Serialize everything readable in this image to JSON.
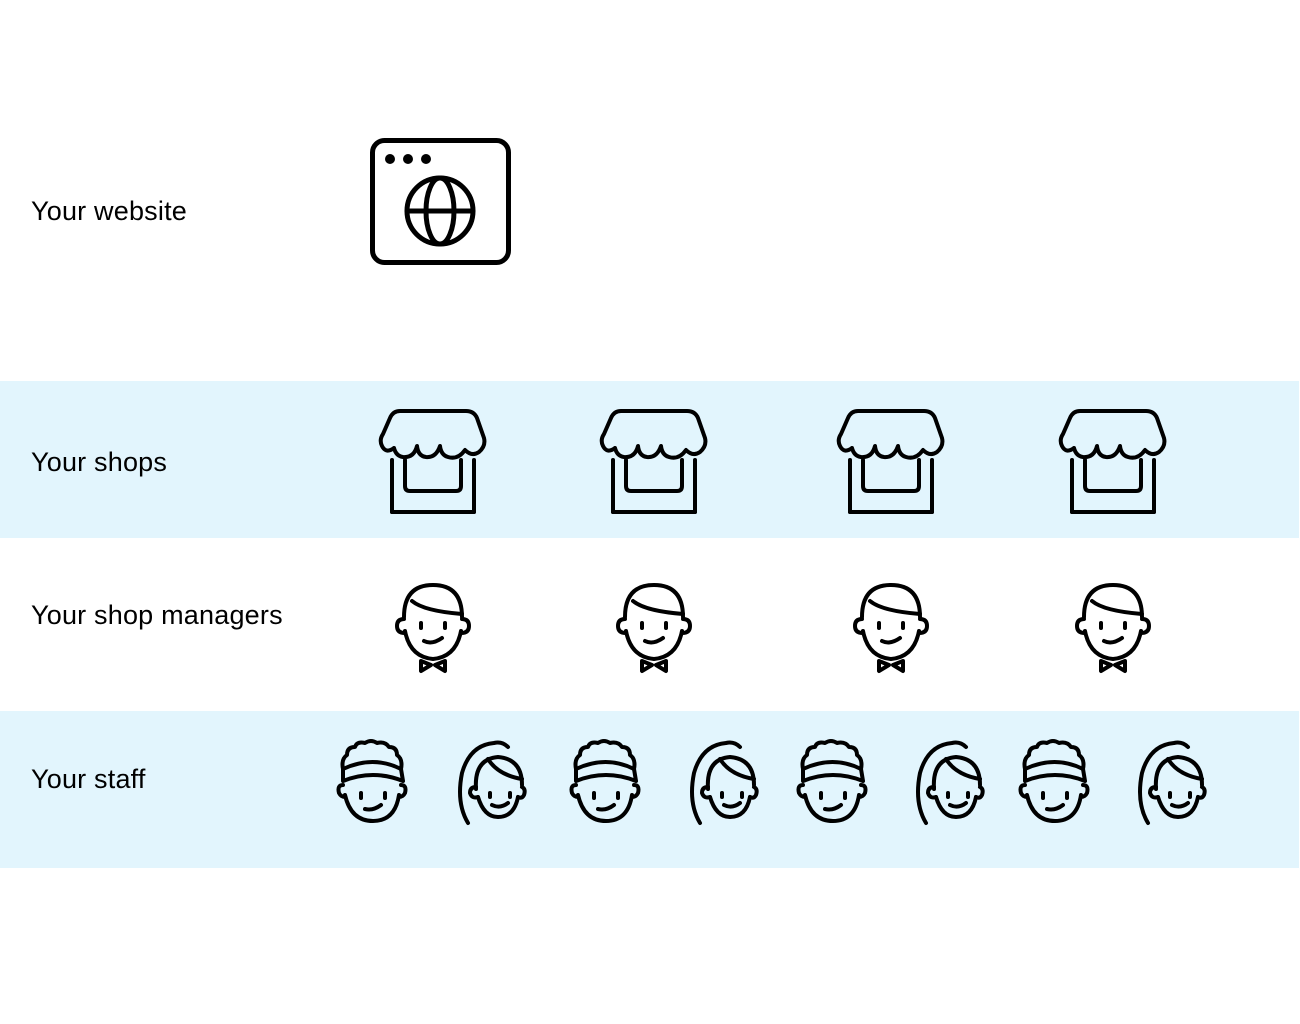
{
  "rows": [
    {
      "label": "Your website",
      "icon": "browser-globe-icon",
      "count": 1,
      "banded": false
    },
    {
      "label": "Your shops",
      "icon": "storefront-icon",
      "count": 4,
      "banded": true
    },
    {
      "label": "Your shop managers",
      "icon": "manager-bowtie-icon",
      "count": 4,
      "banded": false
    },
    {
      "label": "Your staff",
      "icons": [
        "staff-headband-icon",
        "staff-ponytail-icon"
      ],
      "count": 8,
      "banded": true
    }
  ],
  "colors": {
    "band": "#e2f5fd",
    "stroke": "#000000",
    "background": "#ffffff"
  }
}
